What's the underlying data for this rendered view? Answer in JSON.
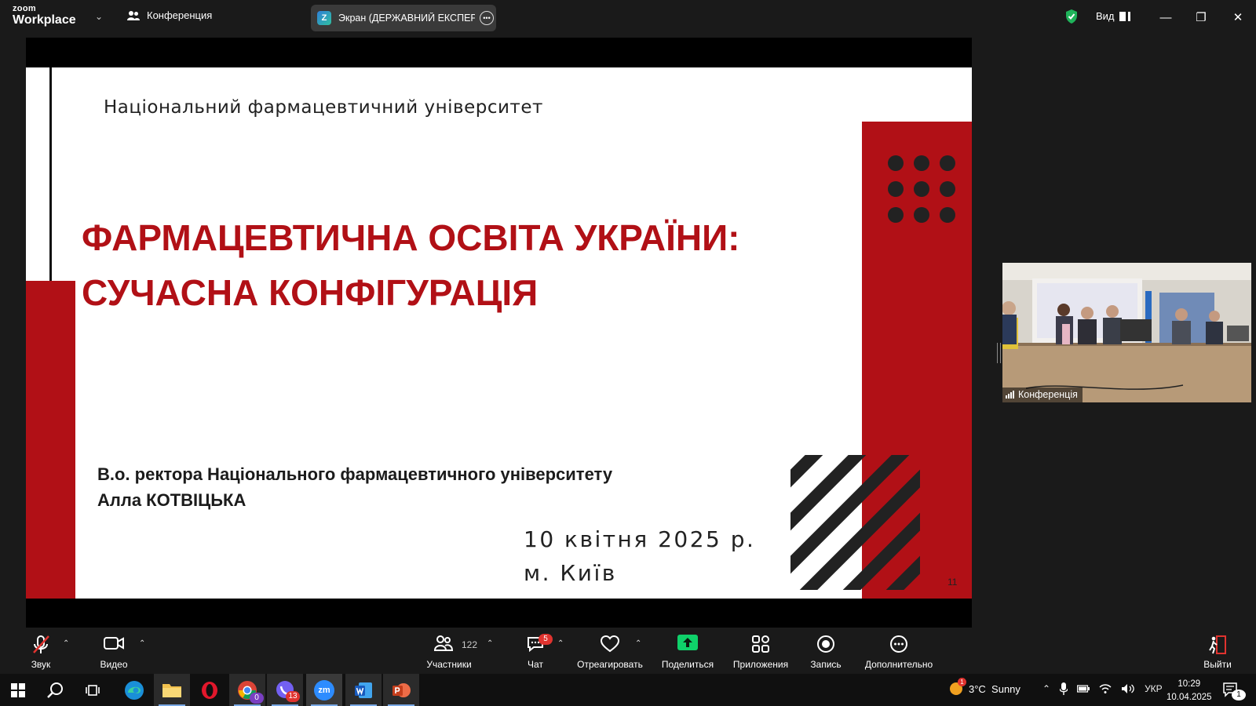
{
  "window": {
    "brand_small": "zoom",
    "brand": "Workplace",
    "meeting_title": "Конференция",
    "share_label": "Экран (ДЕРЖАВНИЙ ЕКСПЕРТН",
    "view_label": "Вид"
  },
  "slide": {
    "university": "Національний фармацевтичний університет",
    "title_line1": "ФАРМАЦЕВТИЧНА ОСВІТА УКРАЇНИ:",
    "title_line2": "СУЧАСНА КОНФІГУРАЦІЯ",
    "speaker_line1": "В.о. ректора Національного фармацевтичного університету",
    "speaker_line2": "Алла КОТВІЦЬКА",
    "date": "10 квітня 2025 р.",
    "city": "м. Київ",
    "page_number": "11",
    "accent_color": "#b11016"
  },
  "video": {
    "name": "Конференція"
  },
  "toolbar": {
    "audio": "Звук",
    "video": "Видео",
    "participants": "Участники",
    "participants_count": "122",
    "chat": "Чат",
    "chat_badge": "5",
    "react": "Отреагировать",
    "share": "Поделиться",
    "apps": "Приложения",
    "record": "Запись",
    "more": "Дополнительно",
    "leave": "Выйти"
  },
  "taskbar": {
    "chrome_badge": "0",
    "viber_badge": "13",
    "zoom_label": "zm",
    "weather_alert": "1",
    "weather": "3°C  Sunny",
    "language": "УКР",
    "time": "10:29",
    "date": "10.04.2025",
    "notifications": "1"
  }
}
